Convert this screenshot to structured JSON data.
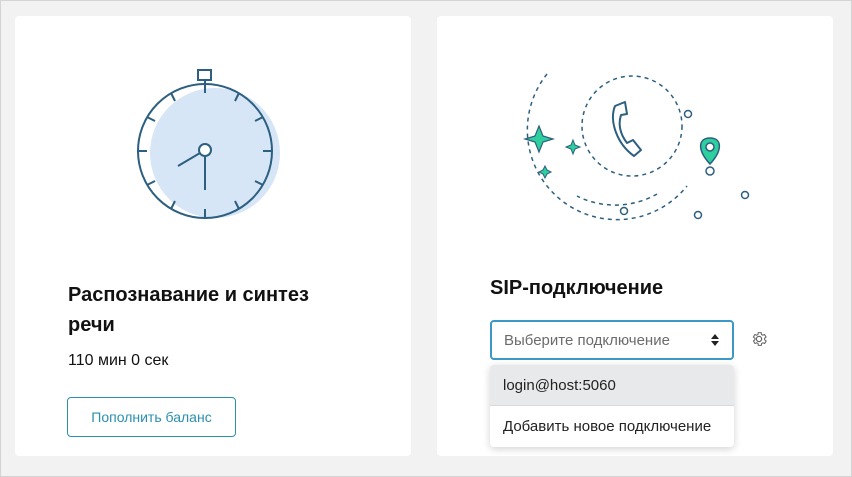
{
  "speech_card": {
    "title": "Распознавание и синтез речи",
    "balance": "110 мин 0 сек",
    "topup_button": "Пополнить баланс"
  },
  "sip_card": {
    "title": "SIP-подключение",
    "select_placeholder": "Выберите подключение",
    "dropdown_items": [
      {
        "label": "login@host:5060"
      },
      {
        "label": "Добавить новое подключение"
      }
    ]
  },
  "icons": {
    "speech_illustration": "stopwatch-icon",
    "sip_illustration": "phone-icon",
    "settings": "gear-icon",
    "select_arrows": "sort-arrows-icon"
  },
  "colors": {
    "accent": "#2a8fb0",
    "illustration_stroke": "#2c5f80",
    "illustration_fill": "#d6e6f6",
    "sparkle": "#2ecf9e"
  }
}
